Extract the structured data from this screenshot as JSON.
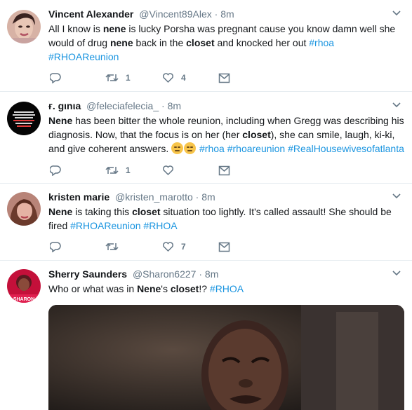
{
  "tweets": [
    {
      "name": "Vincent Alexander",
      "handle": "@Vincent89Alex",
      "dot": "·",
      "time": "8m",
      "text": [
        {
          "t": "All I know is ",
          "s": "plain"
        },
        {
          "t": "nene",
          "s": "bold"
        },
        {
          "t": " is lucky Porsha was pregnant cause you know damn well she would of drug ",
          "s": "plain"
        },
        {
          "t": "nene",
          "s": "bold"
        },
        {
          "t": " back in the ",
          "s": "plain"
        },
        {
          "t": "closet",
          "s": "bold"
        },
        {
          "t": " and knocked her out ",
          "s": "plain"
        },
        {
          "t": "#rhoa",
          "s": "tag"
        },
        {
          "t": " ",
          "s": "plain"
        },
        {
          "t": "#RHOAReunion",
          "s": "tag"
        }
      ],
      "reply_count": "",
      "retweet_count": "1",
      "like_count": "4"
    },
    {
      "name": "ғ. gιnιa",
      "handle": "@feleciafelecia_",
      "dot": "·",
      "time": "8m",
      "text": [
        {
          "t": "Nene",
          "s": "bold"
        },
        {
          "t": " has been bitter the whole reunion, including when Gregg was describing his diagnosis. Now, that the focus is on her (her ",
          "s": "plain"
        },
        {
          "t": "closet",
          "s": "bold"
        },
        {
          "t": "), she can smile, laugh, ki-ki, and give coherent answers. ",
          "s": "plain"
        },
        {
          "t": "",
          "s": "emoji"
        },
        {
          "t": "",
          "s": "emoji"
        },
        {
          "t": " ",
          "s": "plain"
        },
        {
          "t": "#rhoa",
          "s": "tag"
        },
        {
          "t": " ",
          "s": "plain"
        },
        {
          "t": "#rhoareunion",
          "s": "tag"
        },
        {
          "t": " ",
          "s": "plain"
        },
        {
          "t": "#RealHousewivesofatlanta",
          "s": "tag"
        }
      ],
      "reply_count": "",
      "retweet_count": "1",
      "like_count": ""
    },
    {
      "name": "kristen marie",
      "handle": "@kristen_marotto",
      "dot": "·",
      "time": "8m",
      "text": [
        {
          "t": "Nene",
          "s": "bold"
        },
        {
          "t": " is taking this ",
          "s": "plain"
        },
        {
          "t": "closet",
          "s": "bold"
        },
        {
          "t": " situation too lightly. It's called assault! She should be fired ",
          "s": "plain"
        },
        {
          "t": "#RHOAReunion",
          "s": "tag"
        },
        {
          "t": " ",
          "s": "plain"
        },
        {
          "t": "#RHOA",
          "s": "tag"
        }
      ],
      "reply_count": "",
      "retweet_count": "",
      "like_count": "7"
    },
    {
      "name": "Sherry Saunders",
      "handle": "@Sharon6227",
      "dot": "·",
      "time": "8m",
      "text": [
        {
          "t": "Who or what was in ",
          "s": "plain"
        },
        {
          "t": "Nene",
          "s": "bold"
        },
        {
          "t": "'s ",
          "s": "plain"
        },
        {
          "t": "closet",
          "s": "bold"
        },
        {
          "t": "!? ",
          "s": "plain"
        },
        {
          "t": "#RHOA",
          "s": "tag"
        }
      ]
    }
  ],
  "avatar4_caption": "SHARON",
  "colors": {
    "link": "#1b95e0",
    "muted": "#657786",
    "text": "#14171a",
    "divider": "#e6ecf0"
  },
  "icons": [
    "reply-icon",
    "retweet-icon",
    "like-icon",
    "dm-icon",
    "chevron-down-icon"
  ]
}
